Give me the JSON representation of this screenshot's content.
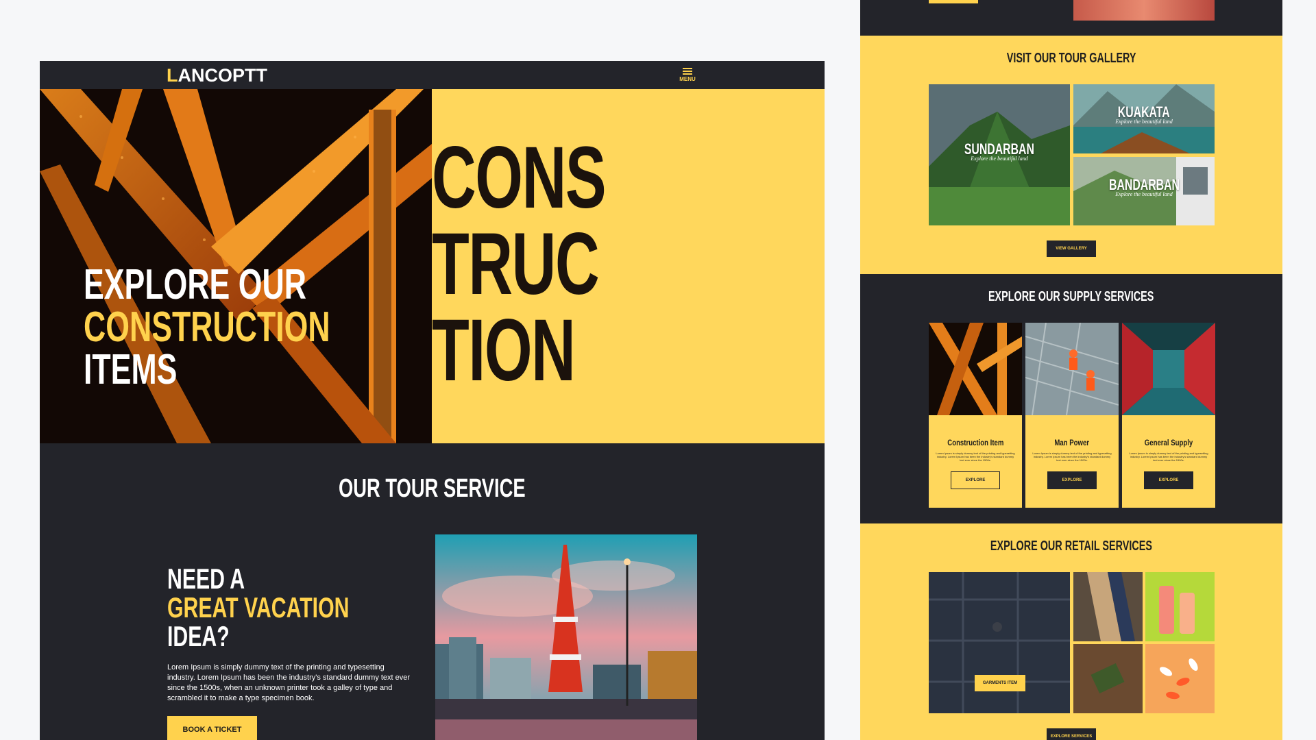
{
  "brand": {
    "logo_text": "ANCOPTT",
    "logo_initial": "L",
    "accent": "#ffd24d",
    "dark": "#23242a"
  },
  "nav": {
    "menu_label": "MENU"
  },
  "hero": {
    "title_line1": "EXPLORE OUR",
    "title_line2": "CONSTRUCTION",
    "title_line3": "ITEMS",
    "big_word_lines": [
      "CONS",
      "TRUC",
      "TION"
    ]
  },
  "tour": {
    "heading": "OUR TOUR SERVICE",
    "title_line1": "NEED A",
    "title_line2": "GREAT VACATION",
    "title_line3": "IDEA?",
    "body": "Lorem Ipsum is simply dummy text of the printing and typesetting industry. Lorem Ipsum has been the industry's standard dummy text ever since the 1500s, when an unknown printer took a galley of type and scrambled it to make a type specimen book.",
    "button": "BOOK A TICKET"
  },
  "gallery": {
    "heading": "VISIT OUR TOUR GALLERY",
    "items": [
      {
        "title": "SUNDARBAN",
        "subtitle": "Explore the beautiful land"
      },
      {
        "title": "KUAKATA",
        "subtitle": "Explore the beautiful land"
      },
      {
        "title": "BANDARBAN",
        "subtitle": "Explore the beautiful land"
      }
    ],
    "button": "VIEW GALLERY"
  },
  "supply": {
    "heading": "EXPLORE OUR SUPPLY SERVICES",
    "cards": [
      {
        "title": "Construction Item",
        "text": "Lorem Ipsum is simply dummy text of the printing and typesetting industry. Lorem Ipsum has been the industry's standard dummy text ever since the 1500s.",
        "button": "EXPLORE"
      },
      {
        "title": "Man Power",
        "text": "Lorem Ipsum is simply dummy text of the printing and typesetting industry. Lorem Ipsum has been the industry's standard dummy text ever since the 1500s.",
        "button": "EXPLORE"
      },
      {
        "title": "General Supply",
        "text": "Lorem Ipsum is simply dummy text of the printing and typesetting industry. Lorem Ipsum has been the industry's standard dummy text ever since the 1500s.",
        "button": "EXPLORE"
      }
    ]
  },
  "retail": {
    "heading": "EXPLORE OUR RETAIL SERVICES",
    "garments_button": "GARMENTS ITEM",
    "button": "EXPLORE SERVICES"
  }
}
